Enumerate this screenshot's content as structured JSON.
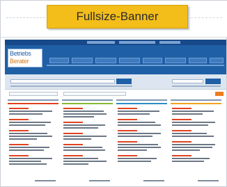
{
  "banner": {
    "label": "Fullsize-Banner",
    "color": "#f3bd1a"
  },
  "site": {
    "logo_line1": "Betriebs",
    "logo_line2": "Berater",
    "brand_color": "#1f5fa6",
    "accent_color": "#e0421f",
    "column_colors": [
      "#e0421f",
      "#8ab83a",
      "#2d8ec4",
      "#f0a21d"
    ]
  }
}
